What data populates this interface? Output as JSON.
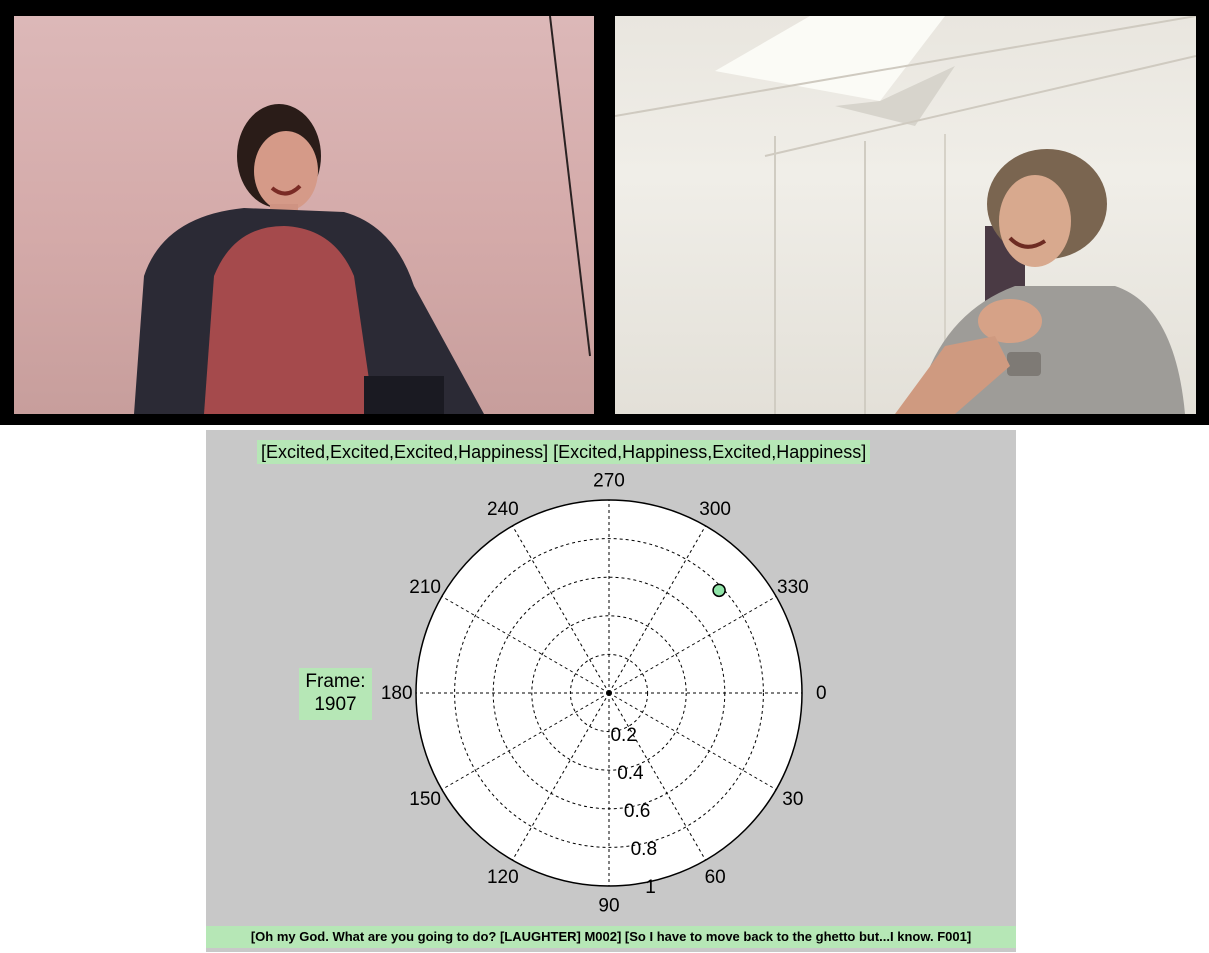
{
  "videos": {
    "left": {
      "icon": "video-frame-woman-laughing"
    },
    "right": {
      "icon": "video-frame-man-laughing"
    }
  },
  "labels": {
    "top": "[Excited,Excited,Excited,Happiness] [Excited,Happiness,Excited,Happiness]",
    "frame_title": "Frame:",
    "frame_number": "1907",
    "bottom": "[Oh my God. What are you going to do? [LAUGHTER] M002] [So I have to move back to the ghetto but...I know. F001]"
  },
  "chart_data": {
    "type": "scatter",
    "coordinate_system": "polar",
    "angular_ticks": [
      "0",
      "30",
      "60",
      "90",
      "120",
      "150",
      "180",
      "210",
      "240",
      "270",
      "300",
      "330"
    ],
    "radial_ticks": [
      "0.2",
      "0.4",
      "0.6",
      "0.8",
      "1"
    ],
    "rlim": [
      0,
      1
    ],
    "angle_direction": "clockwise",
    "grid": true,
    "points": [
      {
        "theta": 317,
        "r": 0.78
      }
    ],
    "colors": {
      "marker": "#90e4a8",
      "box": "#b6e7b6",
      "panel": "#c8c8c8"
    }
  }
}
